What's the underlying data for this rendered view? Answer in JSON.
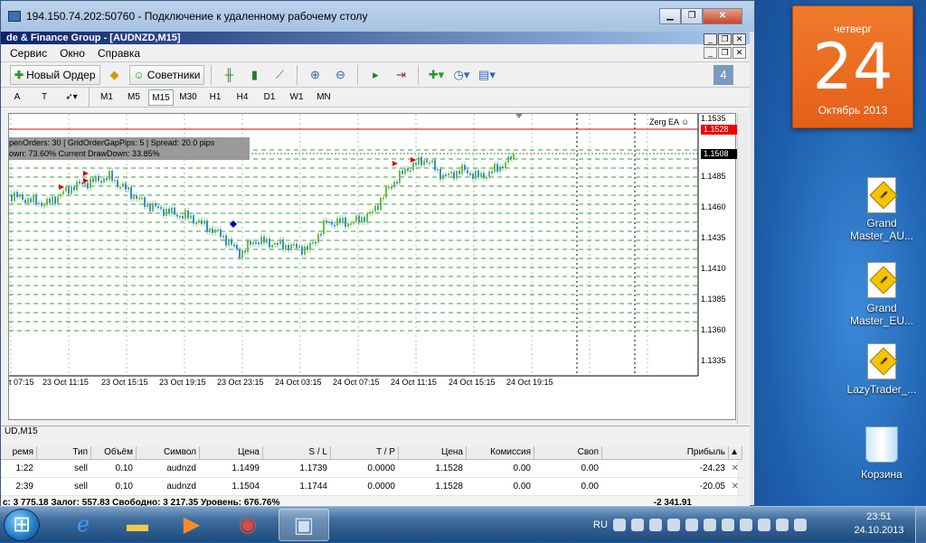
{
  "rdp": {
    "title": "194.150.74.202:50760 - Подключение к удаленному рабочему столу"
  },
  "mt4": {
    "window_title": "de & Finance Group - [AUDNZD,M15]",
    "menu": [
      "Сервис",
      "Окно",
      "Справка"
    ],
    "toolbar": {
      "new_order": "Новый Ордер",
      "advisors": "Советники"
    },
    "timeframes": [
      "M1",
      "M5",
      "M15",
      "M30",
      "H1",
      "H4",
      "D1",
      "W1",
      "MN"
    ],
    "active_timeframe": "M15",
    "chart": {
      "info_line1": "penOrders: 30   |   GridOrderGapPips: 5   |   Spread: 20.0 pips",
      "info_line2": "own: 73.60%                  Current DrawDown: 33.85%",
      "ea_label": "Zerg EA ☺",
      "price_red": "1.1528",
      "price_current": "1.1508",
      "price_ticks": [
        "1.1535",
        "1.1485",
        "1.1460",
        "1.1435",
        "1.1410",
        "1.1385",
        "1.1360",
        "1.1335"
      ],
      "time_labels": [
        "t 07:15",
        "23 Oct 11:15",
        "23 Oct 15:15",
        "23 Oct 19:15",
        "23 Oct 23:15",
        "24 Oct 03:15",
        "24 Oct 07:15",
        "24 Oct 11:15",
        "24 Oct 15:15",
        "24 Oct 19:15"
      ]
    },
    "chart_tab": "UD,M15",
    "terminal": {
      "headers": [
        "ремя",
        "Тип",
        "Объём",
        "Символ",
        "Цена",
        "S / L",
        "T / P",
        "Цена",
        "Комиссия",
        "Своп",
        "Прибыль"
      ],
      "rows": [
        [
          "1:22",
          "sell",
          "0.10",
          "audnzd",
          "1.1499",
          "1.1739",
          "0.0000",
          "1.1528",
          "0.00",
          "0.00",
          "-24.23"
        ],
        [
          "2:39",
          "sell",
          "0.10",
          "audnzd",
          "1.1504",
          "1.1744",
          "0.0000",
          "1.1528",
          "0.00",
          "0.00",
          "-20.05"
        ]
      ],
      "balance": "с: 3 775.18  Залог: 557.83  Свободно: 3 217.35  Уровень: 676.76%",
      "total_profit": "-2 341.91"
    }
  },
  "desktop": {
    "calendar": {
      "weekday": "четверг",
      "day": "24",
      "month": "Октябрь 2013"
    },
    "icons": [
      "Grand Master_AU...",
      "Grand Master_EU...",
      "LazyTrader_...",
      "Корзина"
    ]
  },
  "taskbar": {
    "lang": "RU",
    "time": "23:51",
    "date": "24.10.2013"
  },
  "colors": {
    "bull": "#6abf3a",
    "bear": "#3a8ad6",
    "grid": "#2fa82f",
    "red_line": "#e00000"
  }
}
